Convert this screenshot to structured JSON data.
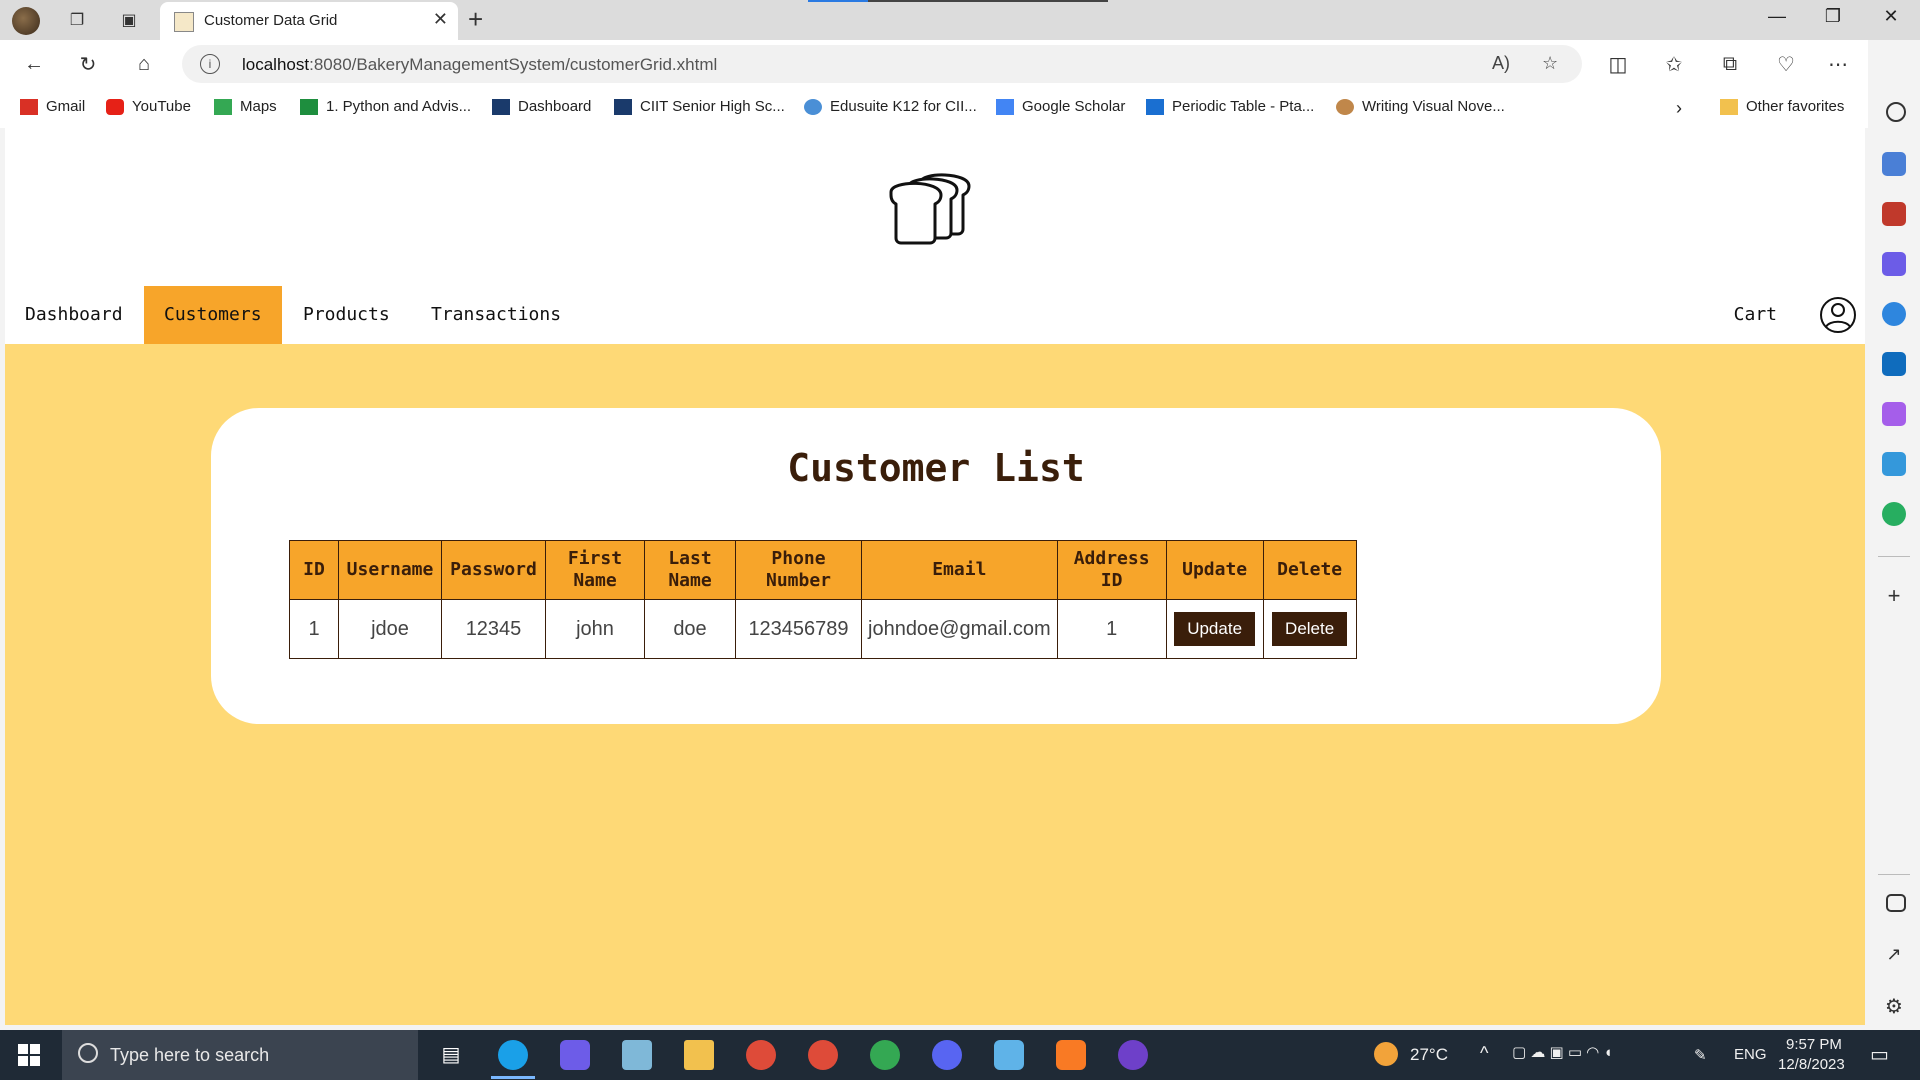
{
  "browser": {
    "tab_title": "Customer Data Grid",
    "url_host": "localhost",
    "url_rest": ":8080/BakeryManagementSystem/customerGrid.xhtml"
  },
  "favorites": [
    {
      "label": "Gmail",
      "icon": "gmail-icon",
      "color": "#d93025"
    },
    {
      "label": "YouTube",
      "icon": "youtube-icon",
      "color": "#e62117"
    },
    {
      "label": "Maps",
      "icon": "maps-icon",
      "color": "#34a853"
    },
    {
      "label": "1. Python and Advis...",
      "icon": "sheets-icon",
      "color": "#1e8e3e"
    },
    {
      "label": "Dashboard",
      "icon": "chart-icon",
      "color": "#1a3a6b"
    },
    {
      "label": "CIIT Senior High Sc...",
      "icon": "chart-icon",
      "color": "#1a3a6b"
    },
    {
      "label": "Edusuite K12 for CII...",
      "icon": "edusuite-icon",
      "color": "#4a8fd6"
    },
    {
      "label": "Google Scholar",
      "icon": "scholar-icon",
      "color": "#4285f4"
    },
    {
      "label": "Periodic Table - Pta...",
      "icon": "pt-icon",
      "color": "#1a6fd1"
    },
    {
      "label": "Writing Visual Nove...",
      "icon": "novel-icon",
      "color": "#c0874a"
    }
  ],
  "favorites_other": "Other favorites",
  "nav": {
    "items": [
      "Dashboard",
      "Customers",
      "Products",
      "Transactions"
    ],
    "active": "Customers",
    "cart": "Cart"
  },
  "page": {
    "title": "Customer List",
    "headers": [
      "ID",
      "Username",
      "Password",
      "First\nName",
      "Last\nName",
      "Phone\nNumber",
      "Email",
      "Address\nID",
      "Update",
      "Delete"
    ],
    "rows": [
      {
        "id": "1",
        "username": "jdoe",
        "password": "12345",
        "first_name": "john",
        "last_name": "doe",
        "phone": "123456789",
        "email": "johndoe@gmail.com",
        "address_id": "1",
        "update_label": "Update",
        "delete_label": "Delete"
      }
    ]
  },
  "taskbar": {
    "search_placeholder": "Type here to search",
    "weather": "27°C",
    "language": "ENG",
    "time": "9:57 PM",
    "date": "12/8/2023"
  },
  "colors": {
    "accent": "#f7a52a",
    "page_bg": "#fed976",
    "dark_brown": "#3a1e0a"
  }
}
